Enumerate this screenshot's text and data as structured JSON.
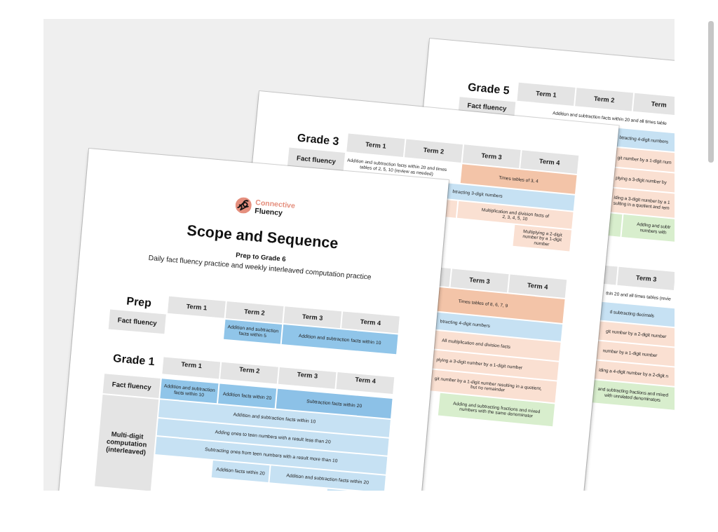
{
  "pages": [
    {
      "kind": "inner",
      "tables": [
        {
          "heading": "Grade 5",
          "columns": [
            "Term 1",
            "Term 2",
            "Term"
          ],
          "rows": [
            {
              "label": "Fact fluency",
              "cells": [
                "",
                {
                  "text": "Addition and subtraction facts within 20 and all times table",
                  "colspan": 2
                }
              ]
            },
            {
              "cells": [
                "",
                {
                  "text": "btracting 4-digit numbers",
                  "color": "#c6e1f3",
                  "colspan": 2
                }
              ]
            },
            {
              "cells": [
                "",
                {
                  "text": "git number by a 1-digit num",
                  "color": "#fae0d2",
                  "colspan": 2
                }
              ]
            },
            {
              "cells": [
                "",
                {
                  "text": "plying a 3-digit number by",
                  "color": "#fae0d2",
                  "colspan": 2
                }
              ]
            },
            {
              "cells": [
                "",
                {
                  "text": "iding a 3-digit number by a 1\nsulting in a quotient and rem",
                  "color": "#fae0d2",
                  "colspan": 2
                }
              ]
            },
            {
              "cells": [
                "",
                {
                  "color": "#d8eecd"
                },
                {
                  "text": "Adding and subtr\nnumbers with",
                  "color": "#d8eecd"
                }
              ]
            }
          ]
        },
        {
          "columns": [
            "",
            "Term 3"
          ],
          "rows": [
            {
              "cells": [
                {
                  "text": "thin 20 and all times tables (revie",
                  "colspan": 2
                }
              ]
            },
            {
              "cells": [
                {
                  "text": "d subtracting decimals",
                  "color": "#c6e1f3",
                  "colspan": 2
                }
              ]
            },
            {
              "cells": [
                {
                  "text": "git number by a 2-digit number",
                  "color": "#fae0d2",
                  "colspan": 2
                }
              ]
            },
            {
              "cells": [
                {
                  "text": "number by a 1-digit number",
                  "color": "#fae0d2",
                  "colspan": 2
                }
              ]
            },
            {
              "cells": [
                {
                  "text": "iding a 4-digit number by a 2-digit n",
                  "color": "#fae0d2",
                  "colspan": 2
                }
              ]
            },
            {
              "cells": [
                {
                  "text": "and subtracting fractions and mixed\nwith unrelated denominators",
                  "color": "#d8eecd",
                  "colspan": 2
                }
              ]
            }
          ]
        }
      ]
    },
    {
      "kind": "inner",
      "tables": [
        {
          "heading": "Grade 3",
          "columns": [
            "Term 1",
            "Term 2",
            "Term 3",
            "Term 4"
          ],
          "rows": [
            {
              "label": "Fact fluency",
              "cells": [
                {
                  "text": "Addition and subtraction facts within 20 and times\ntables of 2, 5, 10 (review as needed)",
                  "colspan": 2
                },
                {
                  "text": "Times tables of 3, 4",
                  "color": "#f3c4a8",
                  "colspan": 2
                }
              ]
            },
            {
              "cells": [
                "",
                {
                  "text": "btracting 3-digit numbers",
                  "color": "#c6e1f3",
                  "colspan": 3
                }
              ]
            },
            {
              "cells": [
                "",
                {
                  "color": "#fae0d2"
                },
                {
                  "text": "Multiplication and division facts of\n2, 3, 4, 5, 10",
                  "color": "#fae0d2",
                  "colspan": 2
                }
              ]
            },
            {
              "cells": [
                "",
                "",
                "",
                {
                  "text": "Multiplying a 2-digit\nnumber by a 1-digit\nnumber",
                  "color": "#fae0d2"
                }
              ]
            }
          ]
        },
        {
          "columns": [
            "",
            "Term 3",
            "Term 4"
          ],
          "rows": [
            {
              "cells": [
                {
                  "text": "Times tables of 8, 6, 7, 9",
                  "color": "#f3c4a8",
                  "colspan": 3
                }
              ]
            },
            {
              "cells": [
                {
                  "text": "btracting 4-digit numbers",
                  "color": "#c6e1f3",
                  "colspan": 3
                }
              ]
            },
            {
              "cells": [
                {
                  "text": "All multiplication and division facts",
                  "color": "#fae0d2",
                  "colspan": 3
                }
              ]
            },
            {
              "cells": [
                {
                  "text": "plying a 3-digit number by a 1-digit number",
                  "color": "#fae0d2",
                  "colspan": 3
                }
              ]
            },
            {
              "cells": [
                {
                  "text": "git number by a 1-digit number resulting in a quotient,\nbut no remainder",
                  "color": "#fae0d2",
                  "colspan": 3
                }
              ]
            },
            {
              "cells": [
                "",
                {
                  "text": "Adding and subtracting fractions and mixed\nnumbers with the same denominator",
                  "color": "#d8eecd",
                  "colspan": 2
                }
              ]
            }
          ]
        }
      ]
    },
    {
      "kind": "cover",
      "logo": {
        "top": "Connective",
        "bottom": "Fluency"
      },
      "title": "Scope and Sequence",
      "subtitle": "Prep to Grade 6",
      "description": "Daily fact fluency practice and weekly interleaved computation practice",
      "tables": [
        {
          "heading": "Prep",
          "columns": [
            "Term 1",
            "Term 2",
            "Term 3",
            "Term 4"
          ],
          "rows": [
            {
              "label": "Fact fluency",
              "cells": [
                "",
                {
                  "text": "Addition and subtraction\nfacts within 5",
                  "color": "#90c5e9"
                },
                {
                  "text": "Addition and subtraction facts within 10",
                  "color": "#90c5e9",
                  "colspan": 2
                }
              ]
            }
          ]
        },
        {
          "heading": "Grade 1",
          "columns": [
            "Term 1",
            "Term 2",
            "Term 3",
            "Term 4"
          ],
          "rows": [
            {
              "label": "Fact fluency",
              "cells": [
                {
                  "text": "Addition and subtraction\nfacts within 10",
                  "color": "#90c5e9"
                },
                {
                  "text": "Addition facts within 20",
                  "color": "#90c5e9"
                },
                {
                  "text": "Subtraction facts within 20",
                  "color": "#8cc1e7",
                  "colspan": 2
                }
              ]
            },
            {
              "label": "Multi-digit computation (interleaved)",
              "cells": [
                {
                  "text": "Addition and subtraction facts within 10",
                  "color": "#c6e1f3",
                  "colspan": 4
                }
              ]
            },
            {
              "cells": [
                {
                  "text": "Adding ones to teen numbers with a result less than 20",
                  "color": "#c6e1f3",
                  "colspan": 4
                }
              ]
            },
            {
              "cells": [
                {
                  "text": "Subtracting ones from teen numbers with a result more than 10",
                  "color": "#c6e1f3",
                  "colspan": 4
                }
              ]
            },
            {
              "cells": [
                "",
                {
                  "text": "Addition facts within 20",
                  "color": "#c6e1f3"
                },
                {
                  "text": "Addition and subtraction facts within 20",
                  "color": "#c6e1f3",
                  "colspan": 2
                }
              ]
            },
            {
              "cells": [
                "",
                "",
                "",
                {
                  "color": "#c6e1f3"
                }
              ]
            }
          ]
        }
      ]
    }
  ]
}
